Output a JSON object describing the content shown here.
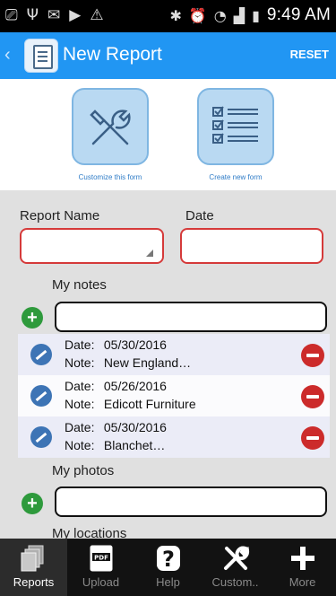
{
  "status_bar": {
    "time": "9:49 AM"
  },
  "app_bar": {
    "back_glyph": "‹",
    "title": "New Report",
    "reset_label": "RESET"
  },
  "tiles": [
    {
      "label": "Customize this form",
      "icon": "tools-icon"
    },
    {
      "label": "Create new form",
      "icon": "checklist-icon"
    }
  ],
  "form": {
    "report_name_label": "Report Name",
    "date_label": "Date",
    "my_notes_label": "My notes",
    "my_photos_label": "My photos",
    "my_locations_label": "My locations"
  },
  "notes": [
    {
      "date_key": "Date:",
      "date": "05/30/2016",
      "note_key": "Note:",
      "note": "New England…"
    },
    {
      "date_key": "Date:",
      "date": "05/26/2016",
      "note_key": "Note:",
      "note": "Edicott Furniture"
    },
    {
      "date_key": "Date:",
      "date": "05/30/2016",
      "note_key": "Note:",
      "note": "Blanchet…"
    }
  ],
  "bottom_nav": [
    {
      "label": "Reports",
      "icon": "reports-icon"
    },
    {
      "label": "Upload",
      "icon": "pdf-upload-icon"
    },
    {
      "label": "Help",
      "icon": "help-icon"
    },
    {
      "label": "Custom..",
      "icon": "tools-icon"
    },
    {
      "label": "More",
      "icon": "plus-icon"
    }
  ],
  "colors": {
    "accent": "#2196f3",
    "delete": "#cc2b2b",
    "add": "#2e9a3c"
  }
}
